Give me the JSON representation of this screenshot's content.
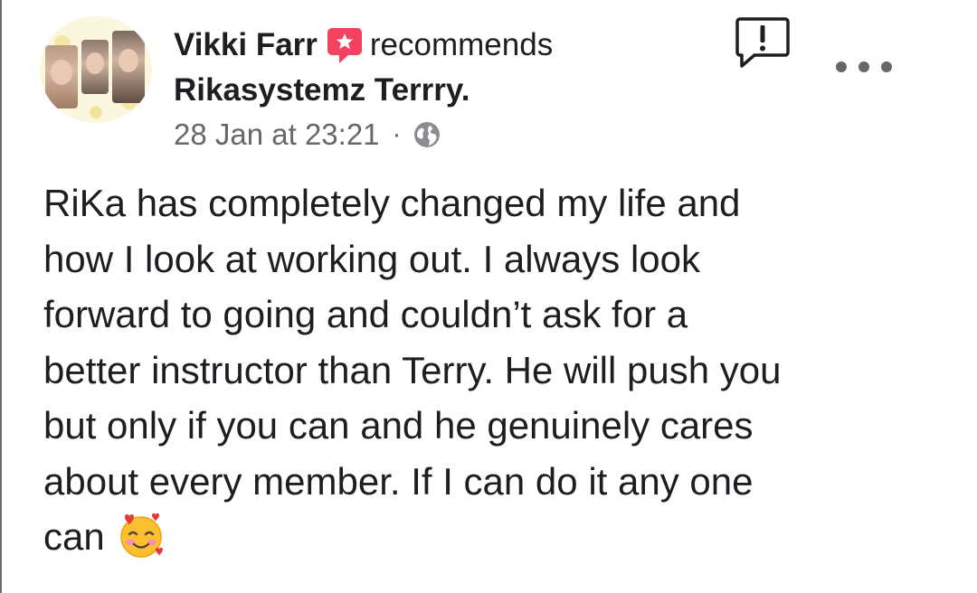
{
  "post": {
    "author": "Vikki Farr",
    "action": "recommends",
    "page": "Rikasystemz Terrry.",
    "timestamp": "28 Jan at 23:21",
    "separator": "·",
    "privacy_icon": "globe-icon",
    "recommend_icon": "recommend-badge-icon",
    "body_lines": [
      "RiKa has completely changed my life and",
      "how I look at working out. I always look",
      "forward to going and couldn’t ask for a",
      "better instructor than Terry. He will push you",
      "but only if you can and he genuinely cares",
      "about every member. If I can do it any one",
      "can"
    ],
    "trailing_emoji": "smiling-face-with-hearts-emoji"
  },
  "actions": {
    "report_icon": "report-icon",
    "more_icon": "more-options-icon"
  },
  "colors": {
    "text_primary": "#1c1e21",
    "text_secondary": "#65676b",
    "recommend_red": "#f3425f"
  }
}
